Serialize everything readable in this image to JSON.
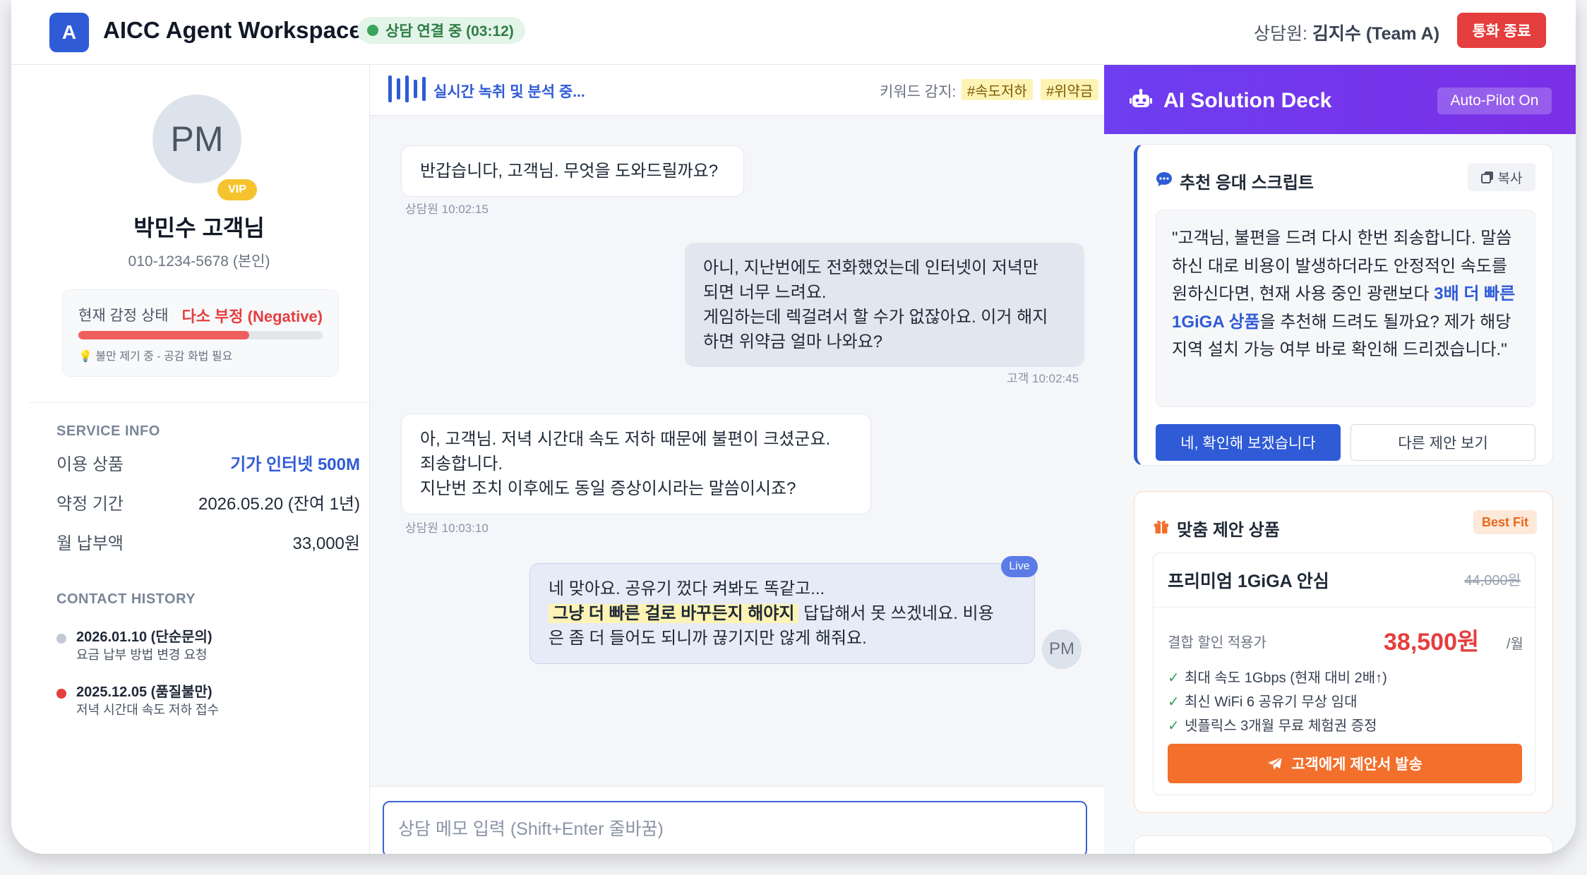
{
  "header": {
    "logo_letter": "A",
    "app_title": "AICC Agent Workspace",
    "connection_status": "상담 연결 중 (03:12)",
    "agent_prefix": "상담원:",
    "agent_name": "김지수 (Team A)",
    "end_call_label": "통화 종료"
  },
  "customer": {
    "initials": "PM",
    "vip_label": "VIP",
    "name": "박민수 고객님",
    "phone": "010-1234-5678 (본인)",
    "emotion_label": "현재 감정 상태",
    "emotion_value": "다소 부정 (Negative)",
    "emotion_level_percent": 70,
    "emotion_hint": "💡 불만 제기 중 - 공감 화법 필요"
  },
  "service_info": {
    "title": "SERVICE INFO",
    "rows": [
      {
        "label": "이용 상품",
        "value": "기가 인터넷 500M"
      },
      {
        "label": "약정 기간",
        "value": "2026.05.20 (잔여 1년)"
      },
      {
        "label": "월 납부액",
        "value": "33,000원"
      }
    ]
  },
  "contact_history": {
    "title": "CONTACT HISTORY",
    "items": [
      {
        "title": "2026.01.10 (단순문의)",
        "desc": "요금 납부 방법 변경 요청",
        "dot_color": "#c3c9d4"
      },
      {
        "title": "2025.12.05 (품질불만)",
        "desc": "저녁 시간대 속도 저하 접수",
        "dot_color": "#e53e3e"
      }
    ]
  },
  "transcript": {
    "status": "실시간 녹취 및 분석 중...",
    "keyword_label": "키워드 감지:",
    "keywords": [
      "#속도저하",
      "#위약금"
    ],
    "messages": [
      {
        "speaker": "agent",
        "lines": [
          "반갑습니다, 고객님. 무엇을 도와드릴까요?"
        ],
        "meta": "상담원 10:02:15"
      },
      {
        "speaker": "customer",
        "lines": [
          "아니, 지난번에도 전화했었는데 인터넷이 저녁만",
          "되면 너무 느려요.",
          "게임하는데 렉걸려서 할 수가 없잖아요. 이거 해지",
          "하면 위약금 얼마 나와요?"
        ],
        "meta": "고객 10:02:45"
      },
      {
        "speaker": "agent",
        "lines": [
          "아, 고객님. 저녁 시간대 속도 저하 때문에 불편이 크셨군요.",
          "죄송합니다.",
          "지난번 조치 이후에도 동일 증상이시라는 말씀이시죠?"
        ],
        "meta": "상담원 10:03:10"
      }
    ],
    "live_message": {
      "tag": "Live",
      "line1": "네 맞아요. 공유기 껐다 켜봐도 똑같고...",
      "highlight": "그냥 더 빠른 걸로 바꾸든지 해야지",
      "line2_rest": "답답해서 못 쓰겠네요. 비용",
      "line3": "은 좀 더 들어도 되니까 끊기지만 않게 해줘요.",
      "avatar": "PM"
    },
    "memo_placeholder": "상담 메모 입력 (Shift+Enter 줄바꿈)"
  },
  "ai_deck": {
    "title": "AI Solution Deck",
    "autopilot": "Auto-Pilot On",
    "script_card": {
      "title": "추천 응대 스크립트",
      "copy_label": "복사",
      "text_before": "\"고객님, 불편을 드려 다시 한번 죄송합니다. 말씀하신 대로 비용이 발생하더라도 안정적인 속도를 원하신다면, 현재 사용 중인 광랜보다 ",
      "text_bold": "3배 더 빠른 1GiGA 상품",
      "text_after": "을 추천해 드려도 될까요? 제가 해당 지역 설치 가능 여부 바로 확인해 드리겠습니다.\"",
      "primary_button": "네, 확인해 보겠습니다",
      "secondary_button": "다른 제안 보기"
    },
    "offer_card": {
      "title": "맞춤 제안 상품",
      "badge": "Best Fit",
      "product_name": "프리미엄 1GiGA 안심",
      "original_price": "44,000원",
      "discount_label": "결합 할인 적용가",
      "price": "38,500원",
      "per_month": "/월",
      "features": [
        "최대 속도 1Gbps (현재 대비 2배↑)",
        "최신 WiFi 6 공유기 무상 임대",
        "넷플릭스 3개월 무료 체험권 증정"
      ],
      "send_button": "고객에게 제안서 발송"
    }
  }
}
